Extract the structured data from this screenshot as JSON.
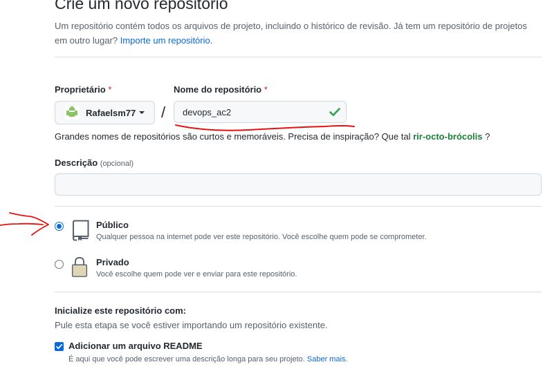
{
  "header": {
    "title": "Crie um novo repositório",
    "subtitle": "Um repositório contém todos os arquivos de projeto, incluindo o histórico de revisão. Já tem um repositório de projetos em outro lugar?",
    "import_link": "Importe um repositório."
  },
  "owner": {
    "label": "Proprietário",
    "required_mark": "*",
    "selected": "Rafaelsm77",
    "avatar_icon": "identicon-avatar",
    "accent_color": "#8cc265"
  },
  "separator": "/",
  "repo_name": {
    "label": "Nome do repositório",
    "required_mark": "*",
    "value": "devops_ac2",
    "valid": true,
    "valid_color": "#1a7f37"
  },
  "hint": {
    "text": "Grandes nomes de repositórios são curtos e memoráveis. Precisa de inspiração? Que tal",
    "suggestion": "rir-octo-brócolis",
    "suffix": "?"
  },
  "description": {
    "label": "Descrição",
    "optional": "(opcional)",
    "value": ""
  },
  "visibility": {
    "public": {
      "title": "Público",
      "description": "Qualquer pessoa na internet pode ver este repositório. Você escolhe quem pode se comprometer.",
      "selected": true,
      "icon": "repo-icon"
    },
    "private": {
      "title": "Privado",
      "description": "Você escolhe quem pode ver e enviar para este repositório.",
      "selected": false,
      "icon": "lock-icon"
    }
  },
  "initialize": {
    "title": "Inicialize este repositório com:",
    "description": "Pule esta etapa se você estiver importando um repositório existente.",
    "readme": {
      "label": "Adicionar um arquivo README",
      "checked": true,
      "description": "É aqui que você pode escrever uma descrição longa para seu projeto.",
      "learn_more": "Saber mais."
    }
  },
  "annotation_color": "#e8100f",
  "accent_color": "#0969da"
}
